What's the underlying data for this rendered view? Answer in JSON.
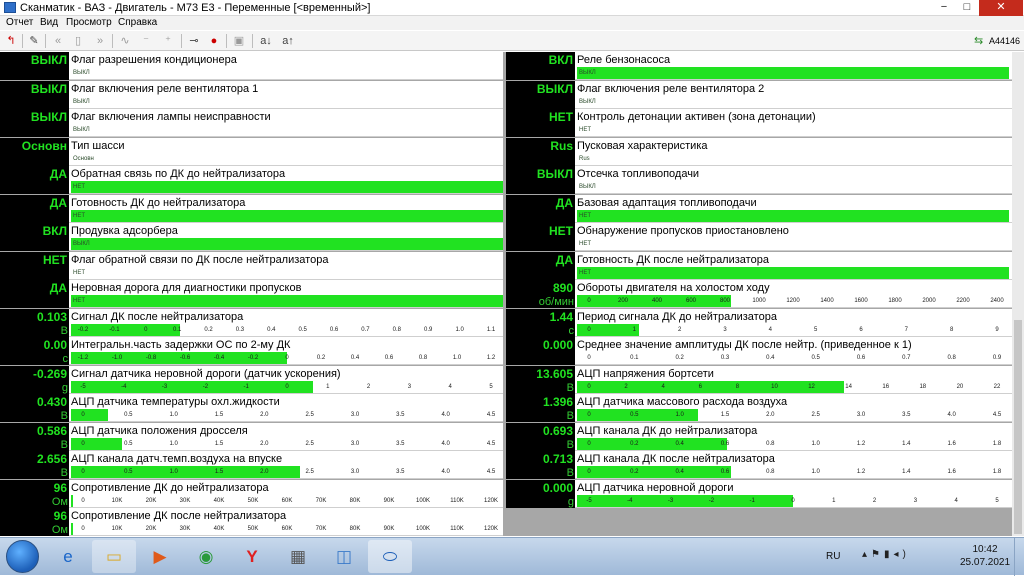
{
  "window": {
    "title": "Сканматик - ВАЗ - Двигатель - M73 E3 - Переменные [<временный>]",
    "min": "−",
    "max": "□",
    "close": "✕"
  },
  "menu": [
    "Отчет",
    "Вид",
    "Просмотр",
    "Справка"
  ],
  "toolbar": {
    "serial": "A44146"
  },
  "rows": [
    {
      "value": "ВЫКЛ",
      "unit": "",
      "label": "Флаг разрешения кондиционера",
      "state": "ВЫКЛ",
      "fill": 0,
      "ticks": []
    },
    {
      "value": "ВКЛ",
      "unit": "",
      "label": "Реле бензонасоса",
      "state": "ВЫКЛ",
      "fill": 1,
      "ticks": []
    },
    {
      "value": "ВЫКЛ",
      "unit": "",
      "label": "Флаг включения реле вентилятора 1",
      "state": "ВЫКЛ",
      "fill": 0,
      "ticks": []
    },
    {
      "value": "ВЫКЛ",
      "unit": "",
      "label": "Флаг включения реле вентилятора 2",
      "state": "ВЫКЛ",
      "fill": 0,
      "ticks": []
    },
    {
      "value": "ВЫКЛ",
      "unit": "",
      "label": "Флаг включения лампы неисправности",
      "state": "ВЫКЛ",
      "fill": 0,
      "ticks": []
    },
    {
      "value": "НЕТ",
      "unit": "",
      "label": "Контроль детонации активен (зона детонации)",
      "state": "НЕТ",
      "fill": 0,
      "ticks": []
    },
    {
      "value": "Основн",
      "unit": "",
      "label": "Тип шасси",
      "state": "Основн",
      "fill": 0,
      "ticks": []
    },
    {
      "value": "Rus",
      "unit": "",
      "label": "Пусковая характеристика",
      "state": "Rus",
      "fill": 0,
      "ticks": []
    },
    {
      "value": "ДА",
      "unit": "",
      "label": "Обратная связь по ДК до нейтрализатора",
      "state": "НЕТ",
      "fill": 1,
      "ticks": []
    },
    {
      "value": "ВЫКЛ",
      "unit": "",
      "label": "Отсечка топливоподачи",
      "state": "ВЫКЛ",
      "fill": 0,
      "ticks": []
    },
    {
      "value": "ДА",
      "unit": "",
      "label": "Готовность ДК до нейтрализатора",
      "state": "НЕТ",
      "fill": 1,
      "ticks": []
    },
    {
      "value": "ДА",
      "unit": "",
      "label": "Базовая адаптация топливоподачи",
      "state": "НЕТ",
      "fill": 1,
      "ticks": []
    },
    {
      "value": "ВКЛ",
      "unit": "",
      "label": "Продувка адсорбера",
      "state": "ВЫКЛ",
      "fill": 1,
      "ticks": []
    },
    {
      "value": "НЕТ",
      "unit": "",
      "label": "Обнаружение пропусков приостановлено",
      "state": "НЕТ",
      "fill": 0,
      "ticks": []
    },
    {
      "value": "НЕТ",
      "unit": "",
      "label": "Флаг обратной связи по ДК после нейтрализатора",
      "state": "НЕТ",
      "fill": 0,
      "ticks": []
    },
    {
      "value": "ДА",
      "unit": "",
      "label": "Готовность ДК после нейтрализатора",
      "state": "НЕТ",
      "fill": 1,
      "ticks": []
    },
    {
      "value": "ДА",
      "unit": "",
      "label": "Неровная дорога для диагностики пропусков",
      "state": "НЕТ",
      "fill": 1,
      "ticks": []
    },
    {
      "value": "890",
      "unit": "об/мин",
      "label": "Обороты двигателя на холостом ходу",
      "state": "",
      "fill": 0.356,
      "ticks": [
        "0",
        "200",
        "400",
        "600",
        "800",
        "1000",
        "1200",
        "1400",
        "1600",
        "1800",
        "2000",
        "2200",
        "2400"
      ]
    },
    {
      "value": "0.103",
      "unit": "В",
      "label": "Сигнал ДК после нейтрализатора",
      "state": "",
      "fill": 0.252,
      "ticks": [
        "-0.2",
        "-0.1",
        "0",
        "0.1",
        "0.2",
        "0.3",
        "0.4",
        "0.5",
        "0.6",
        "0.7",
        "0.8",
        "0.9",
        "1.0",
        "1.1"
      ]
    },
    {
      "value": "1.44",
      "unit": "с",
      "label": "Период сигнала ДК до нейтрализатора",
      "state": "",
      "fill": 0.144,
      "ticks": [
        "0",
        "1",
        "2",
        "3",
        "4",
        "5",
        "6",
        "7",
        "8",
        "9"
      ]
    },
    {
      "value": "0.00",
      "unit": "с",
      "label": "Интегральн.часть задержки ОС по 2-му ДК",
      "state": "",
      "fill": 0.5,
      "ticks": [
        "-1.2",
        "-1.0",
        "-0.8",
        "-0.6",
        "-0.4",
        "-0.2",
        "0",
        "0.2",
        "0.4",
        "0.6",
        "0.8",
        "1.0",
        "1.2"
      ]
    },
    {
      "value": "0.000",
      "unit": "",
      "label": "Среднее значение амплитуды ДК после нейтр. (приведенное к 1)",
      "state": "",
      "fill": 0,
      "ticks": [
        "0",
        "0.1",
        "0.2",
        "0.3",
        "0.4",
        "0.5",
        "0.6",
        "0.7",
        "0.8",
        "0.9"
      ]
    },
    {
      "value": "-0.269",
      "unit": "g",
      "label": "Сигнал датчика неровной дороги (датчик ускорения)",
      "state": "",
      "fill": 0.56,
      "ticks": [
        "-5",
        "-4",
        "-3",
        "-2",
        "-1",
        "0",
        "1",
        "2",
        "3",
        "4",
        "5"
      ]
    },
    {
      "value": "13.605",
      "unit": "В",
      "label": "АЦП напряжения бортсети",
      "state": "",
      "fill": 0.618,
      "ticks": [
        "0",
        "2",
        "4",
        "6",
        "8",
        "10",
        "12",
        "14",
        "16",
        "18",
        "20",
        "22"
      ]
    },
    {
      "value": "0.430",
      "unit": "В",
      "label": "АЦП датчика температуры охл.жидкости",
      "state": "",
      "fill": 0.086,
      "ticks": [
        "0",
        "0.5",
        "1.0",
        "1.5",
        "2.0",
        "2.5",
        "3.0",
        "3.5",
        "4.0",
        "4.5"
      ]
    },
    {
      "value": "1.396",
      "unit": "В",
      "label": "АЦП датчика массового расхода воздуха",
      "state": "",
      "fill": 0.279,
      "ticks": [
        "0",
        "0.5",
        "1.0",
        "1.5",
        "2.0",
        "2.5",
        "3.0",
        "3.5",
        "4.0",
        "4.5"
      ]
    },
    {
      "value": "0.586",
      "unit": "В",
      "label": "АЦП датчика положения дросселя",
      "state": "",
      "fill": 0.117,
      "ticks": [
        "0",
        "0.5",
        "1.0",
        "1.5",
        "2.0",
        "2.5",
        "3.0",
        "3.5",
        "4.0",
        "4.5"
      ]
    },
    {
      "value": "0.693",
      "unit": "В",
      "label": "АЦП канала ДК до нейтрализатора",
      "state": "",
      "fill": 0.347,
      "ticks": [
        "0",
        "0.2",
        "0.4",
        "0.6",
        "0.8",
        "1.0",
        "1.2",
        "1.4",
        "1.6",
        "1.8"
      ]
    },
    {
      "value": "2.656",
      "unit": "В",
      "label": "АЦП канала датч.темп.воздуха на впуске",
      "state": "",
      "fill": 0.531,
      "ticks": [
        "0",
        "0.5",
        "1.0",
        "1.5",
        "2.0",
        "2.5",
        "3.0",
        "3.5",
        "4.0",
        "4.5"
      ]
    },
    {
      "value": "0.713",
      "unit": "В",
      "label": "АЦП канала ДК после нейтрализатора",
      "state": "",
      "fill": 0.357,
      "ticks": [
        "0",
        "0.2",
        "0.4",
        "0.6",
        "0.8",
        "1.0",
        "1.2",
        "1.4",
        "1.6",
        "1.8"
      ]
    },
    {
      "value": "96",
      "unit": "Ом",
      "label": "Сопротивление ДК до нейтрализатора",
      "state": "",
      "fill": 0.003,
      "ticks": [
        "0",
        "10K",
        "20K",
        "30K",
        "40K",
        "50K",
        "60K",
        "70K",
        "80K",
        "90K",
        "100K",
        "110K",
        "120K"
      ]
    },
    {
      "value": "0.000",
      "unit": "g",
      "label": "АЦП датчика неровной дороги",
      "state": "",
      "fill": 0.5,
      "ticks": [
        "-5",
        "-4",
        "-3",
        "-2",
        "-1",
        "0",
        "1",
        "2",
        "3",
        "4",
        "5"
      ]
    },
    {
      "value": "96",
      "unit": "Ом",
      "label": "Сопротивление ДК после нейтрализатора",
      "state": "",
      "fill": 0.003,
      "ticks": [
        "0",
        "10K",
        "20K",
        "30K",
        "40K",
        "50K",
        "60K",
        "70K",
        "80K",
        "90K",
        "100K",
        "110K",
        "120K"
      ]
    }
  ],
  "taskbar": {
    "language": "RU",
    "time": "10:42",
    "date": "25.07.2021"
  }
}
